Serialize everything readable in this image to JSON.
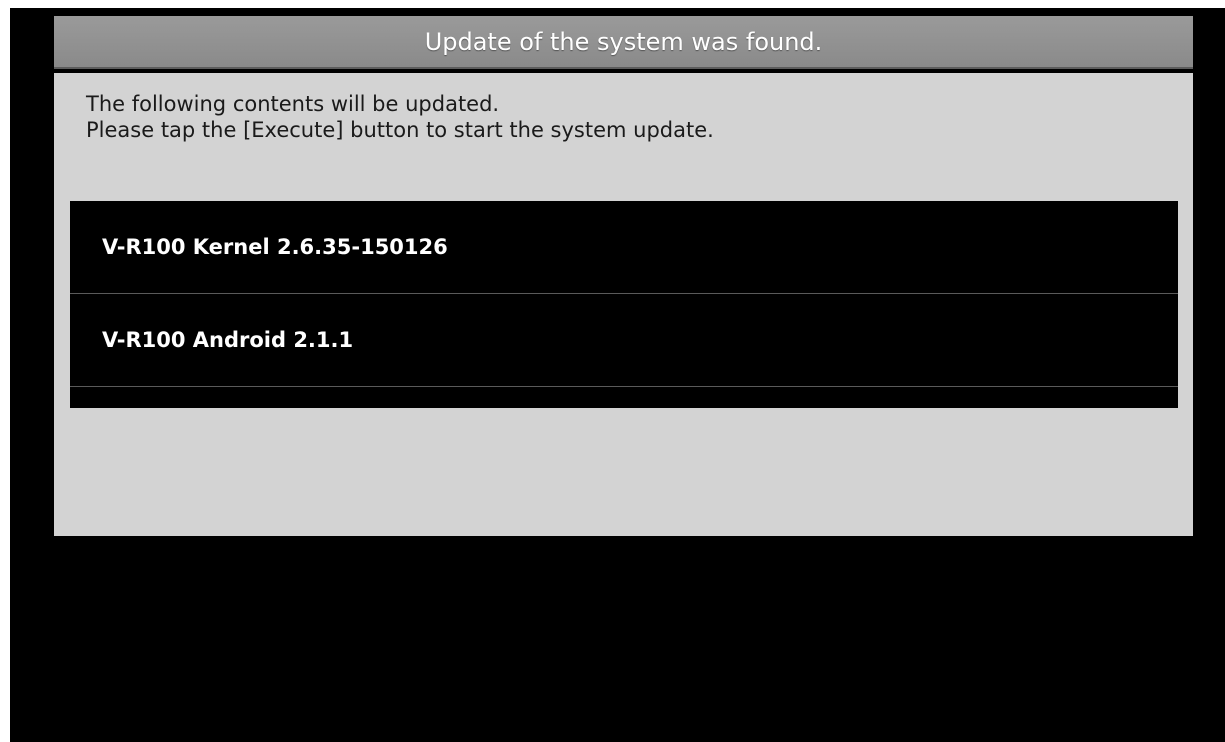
{
  "dialog": {
    "title": "Update of the system was found.",
    "instructions": [
      "The following contents will be updated.",
      "Please tap the [Execute] button to start the system update."
    ],
    "updates": [
      "V-R100 Kernel 2.6.35-150126",
      "V-R100 Android 2.1.1"
    ]
  },
  "colors": {
    "background": "#000000",
    "title_bar": "#919191",
    "panel": "#d3d3d3",
    "list_background": "#000000",
    "list_text": "#ffffff"
  }
}
